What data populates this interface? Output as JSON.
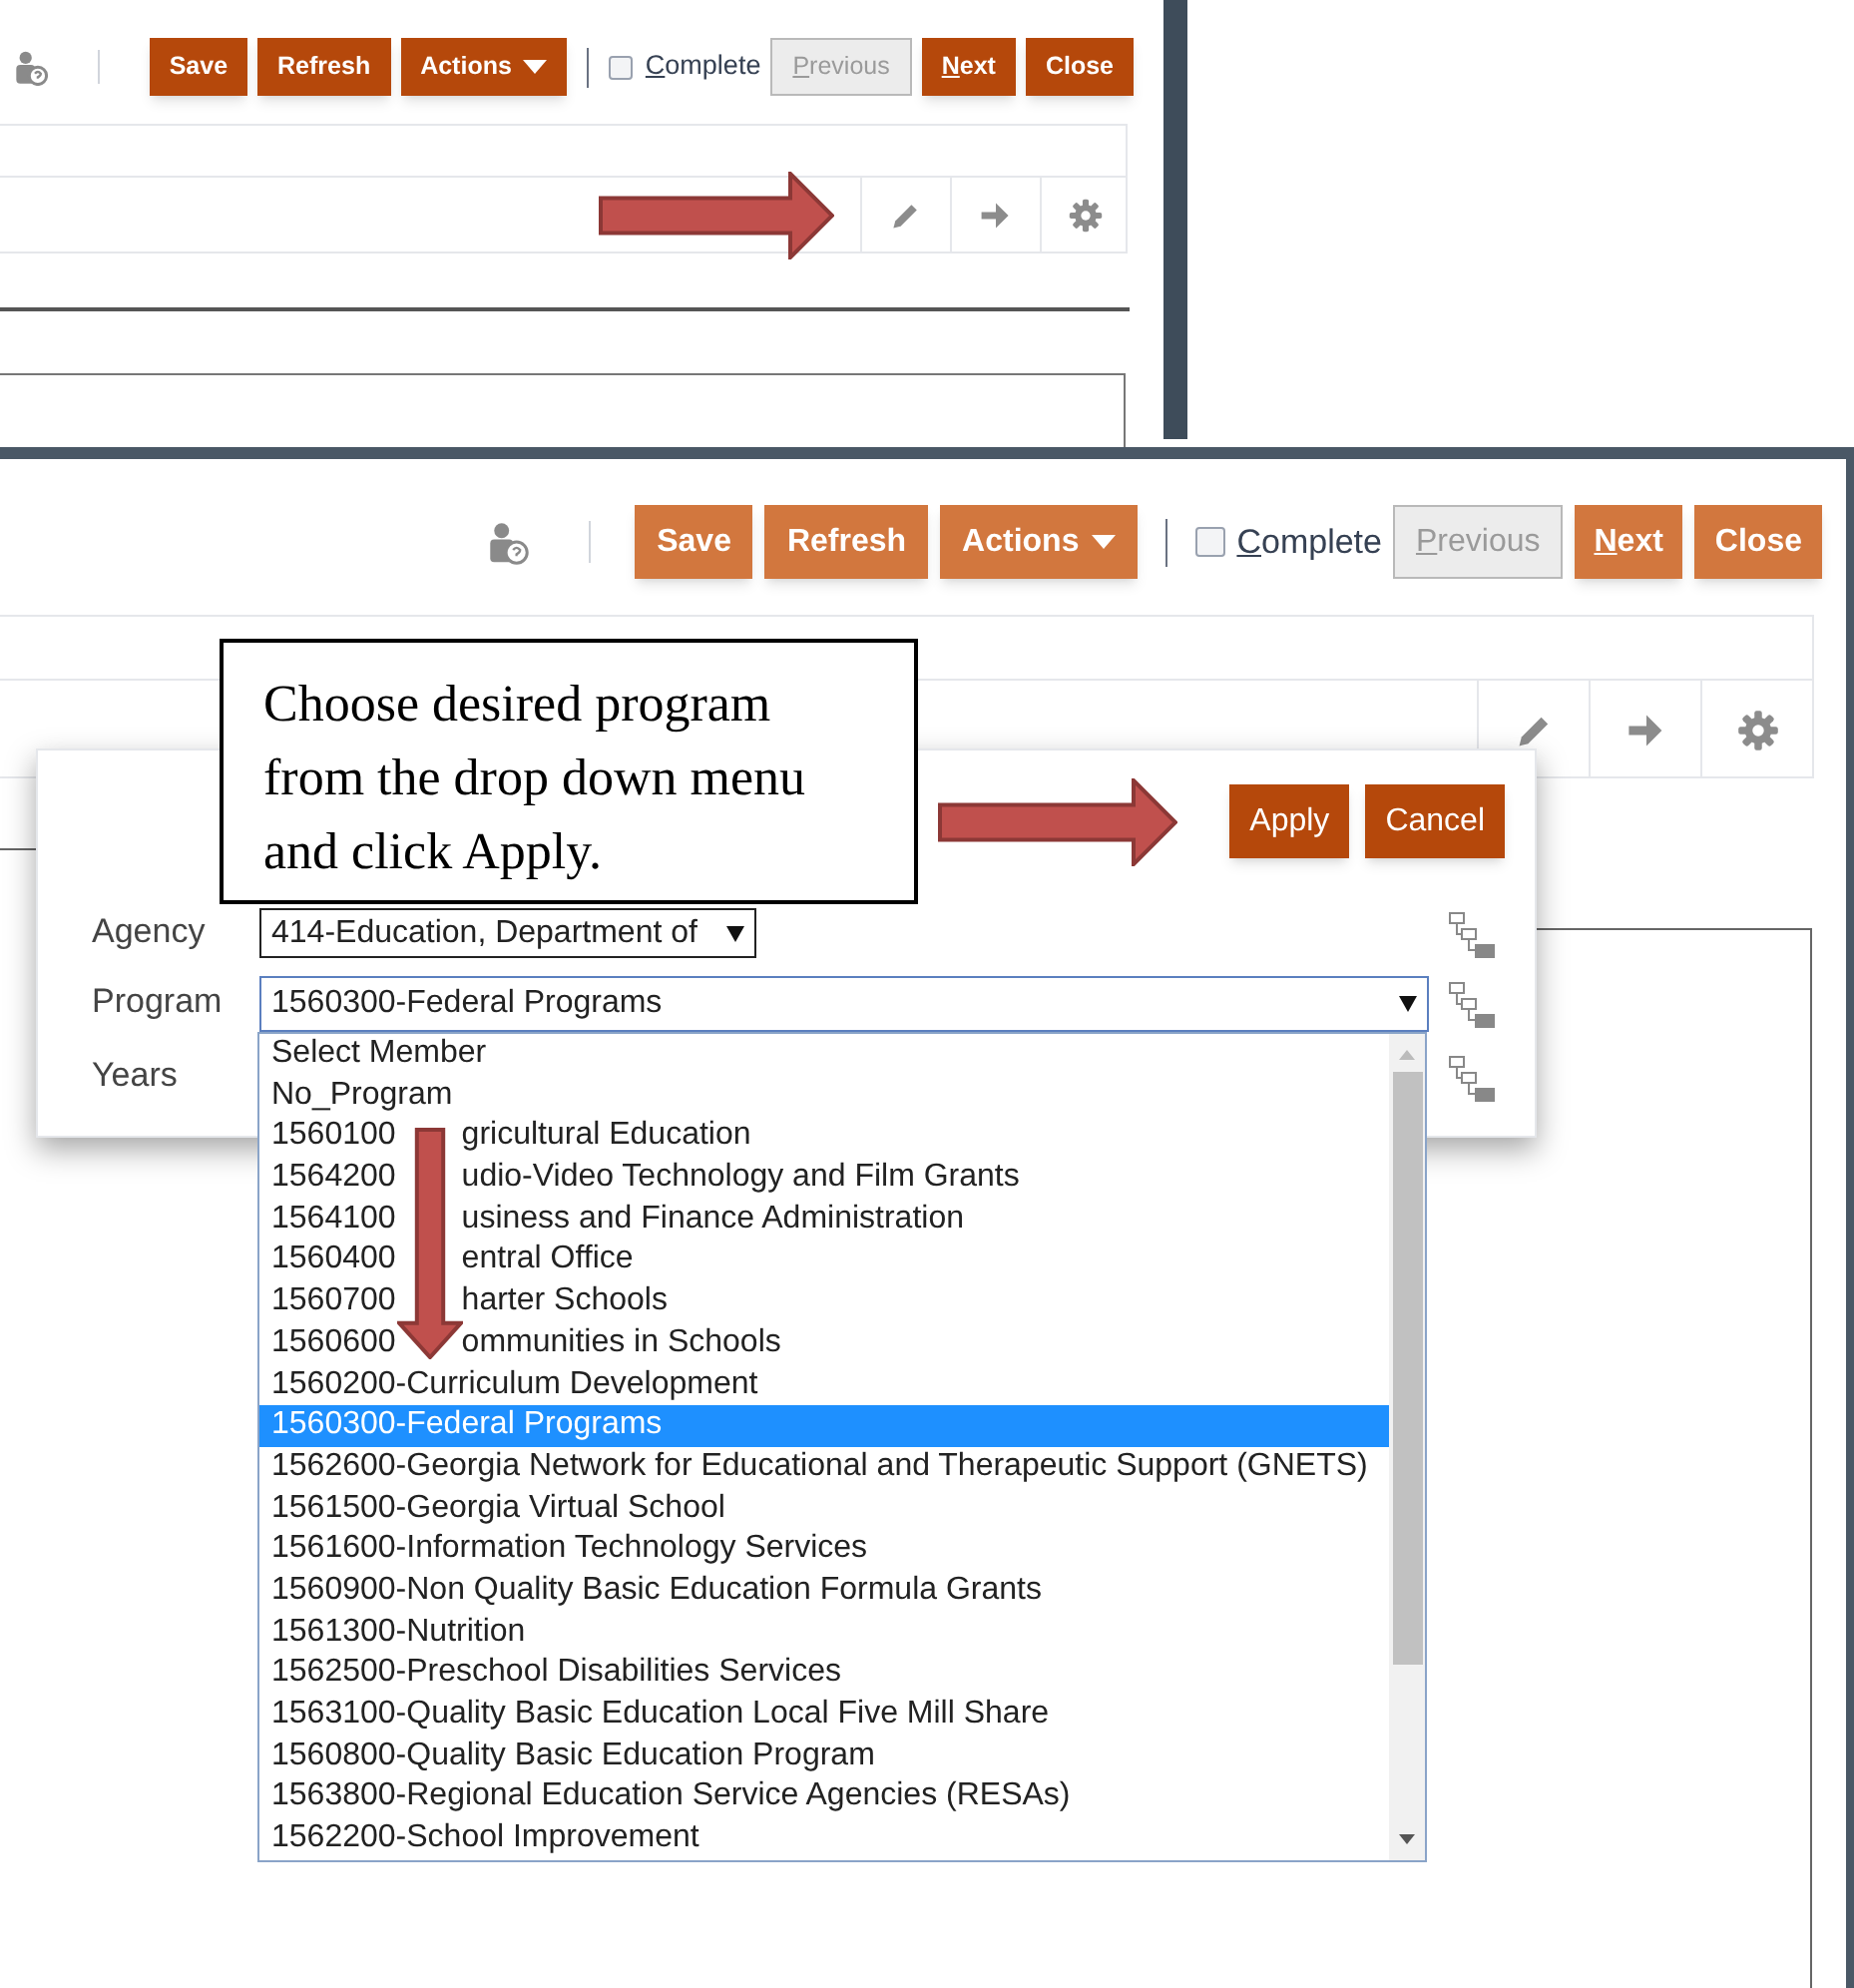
{
  "top_screenshot": {
    "toolbar": {
      "buttons": [
        {
          "label": "Save",
          "kind": "plain"
        },
        {
          "label": "Refresh",
          "kind": "plain"
        },
        {
          "label": "Actions",
          "kind": "menu"
        }
      ],
      "complete": {
        "label": "Complete",
        "checked": false,
        "mnemonic": true
      },
      "nav_buttons": [
        {
          "label": "Previous",
          "disabled": true,
          "mnemonic": true
        },
        {
          "label": "Next",
          "disabled": false,
          "mnemonic": true
        },
        {
          "label": "Close",
          "disabled": false,
          "mnemonic": false
        }
      ]
    }
  },
  "bottom_screenshot": {
    "toolbar": {
      "buttons": [
        {
          "label": "Save",
          "kind": "plain"
        },
        {
          "label": "Refresh",
          "kind": "plain"
        },
        {
          "label": "Actions",
          "kind": "menu"
        }
      ],
      "complete": {
        "label": "Complete",
        "checked": false,
        "mnemonic": true
      },
      "nav_buttons": [
        {
          "label": "Previous",
          "disabled": true,
          "mnemonic": true
        },
        {
          "label": "Next",
          "disabled": false,
          "mnemonic": true
        },
        {
          "label": "Close",
          "disabled": false,
          "mnemonic": false
        }
      ]
    },
    "callout": {
      "text": "Choose desired program from the drop down menu and click Apply."
    },
    "dialog": {
      "buttons": [
        {
          "label": "Apply"
        },
        {
          "label": "Cancel"
        }
      ],
      "fields": [
        {
          "label": "Agency",
          "kind": "select",
          "value": "414-Education, Department of",
          "expanded": false
        },
        {
          "label": "Program",
          "kind": "select",
          "value": "1560300-Federal Programs",
          "expanded": true
        },
        {
          "label": "Years",
          "kind": "hidden"
        }
      ],
      "options": [
        {
          "label": "Select Member",
          "selected": false
        },
        {
          "label": "No_Program",
          "selected": false
        },
        {
          "label_parts": [
            "1560100",
            "gricultural Education"
          ],
          "selected": false
        },
        {
          "label_parts": [
            "1564200",
            "udio-Video Technology and Film Grants"
          ],
          "selected": false
        },
        {
          "label_parts": [
            "1564100",
            "usiness and Finance Administration"
          ],
          "selected": false
        },
        {
          "label_parts": [
            "1560400",
            "entral Office"
          ],
          "selected": false
        },
        {
          "label_parts": [
            "1560700",
            "harter Schools"
          ],
          "selected": false
        },
        {
          "label_parts": [
            "1560600",
            "ommunities in Schools"
          ],
          "selected": false
        },
        {
          "label": "1560200-Curriculum Development",
          "selected": false
        },
        {
          "label": "1560300-Federal Programs",
          "selected": true
        },
        {
          "label": "1562600-Georgia Network for Educational and Therapeutic Support (GNETS)",
          "selected": false
        },
        {
          "label": "1561500-Georgia Virtual School",
          "selected": false
        },
        {
          "label": "1561600-Information Technology Services",
          "selected": false
        },
        {
          "label": "1560900-Non Quality Basic Education Formula Grants",
          "selected": false
        },
        {
          "label": "1561300-Nutrition",
          "selected": false
        },
        {
          "label": "1562500-Preschool Disabilities Services",
          "selected": false
        },
        {
          "label": "1563100-Quality Basic Education Local Five Mill Share",
          "selected": false
        },
        {
          "label": "1560800-Quality Basic Education Program",
          "selected": false
        },
        {
          "label": "1563800-Regional Education Service Agencies (RESAs)",
          "selected": false
        },
        {
          "label": "1562200-School Improvement",
          "selected": false
        }
      ]
    }
  }
}
